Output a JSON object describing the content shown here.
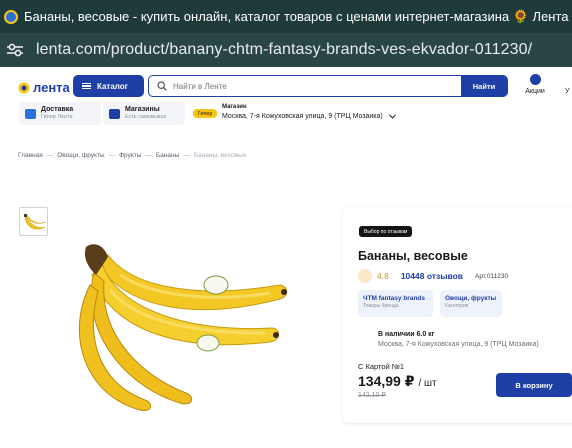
{
  "browser": {
    "tab_title": "Бананы, весовые - купить онлайн, каталог товаров с ценами интернет-магазина 🌻 Лента | Москва, Сан",
    "url": "lenta.com/product/banany-chtm-fantasy-brands-ves-ekvador-011230/"
  },
  "header": {
    "logo_text": "лента",
    "catalog_label": "Каталог",
    "search_placeholder": "Найти в Ленте",
    "search_button": "Найти",
    "promo_label": "Акции",
    "cut_label": "У"
  },
  "delivery": {
    "delivery_title": "Доставка",
    "delivery_sub": "Гипер Лента",
    "stores_title": "Магазины",
    "stores_sub": "Есть самовывоз",
    "store_badge": "Гипер",
    "store_heading": "Магазин",
    "store_address": "Москва, 7-я Кожуховская улица, 9 (ТРЦ Мозаика)"
  },
  "breadcrumb": [
    "Главная",
    "Овощи, фрукты",
    "Фрукты",
    "Бананы",
    "Бананы, весовые"
  ],
  "product": {
    "badge": "Выбор по отзывам",
    "title": "Бананы, весовые",
    "rating": "4.8",
    "reviews": "10448 отзывов",
    "article": "Арт.011230",
    "brand_title": "ЧТМ fantasy brands",
    "brand_sub": "Товары бренда",
    "category_title": "Овощи, фрукты",
    "category_sub": "Категория",
    "stock_title": "В наличии 6.0 кг",
    "stock_address": "Москва, 7-я Кожуховская улица, 9 (ТРЦ Мозаика)",
    "price_label": "С Картой №1",
    "price": "134,99 ₽",
    "price_unit": "/ шт",
    "old_price": "142,10 ₽",
    "cart_button": "В корзину"
  },
  "colors": {
    "brand_blue": "#1d3fa6",
    "banana_yellow": "#f5c518",
    "titlebar": "#1f3a3a"
  }
}
